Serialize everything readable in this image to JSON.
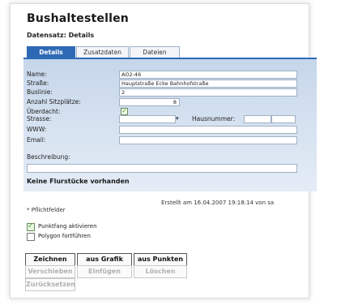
{
  "title": "Bushaltestellen",
  "subtitle": "Datensatz: Details",
  "tabs": [
    {
      "label": "Details",
      "active": true
    },
    {
      "label": "Zusatzdaten",
      "active": false
    },
    {
      "label": "Dateien",
      "active": false
    }
  ],
  "form": {
    "name": {
      "label": "Name:",
      "value": "AO2-46"
    },
    "strasse": {
      "label": "Straße:",
      "value": "Hauptstraße Ecke Bahnhofstraße"
    },
    "buslinie": {
      "label": "Buslinie:",
      "value": "2"
    },
    "sitzplaetze": {
      "label": "Anzahl Sitzplätze:",
      "value": "8"
    },
    "ueberdacht": {
      "label": "Überdacht:",
      "checked": true
    },
    "strasse2": {
      "label": "Strasse:",
      "value": "",
      "dropdown_symbol": "▾"
    },
    "hausnummer": {
      "label": "Hausnummer:",
      "value": "",
      "value2": ""
    },
    "www": {
      "label": "WWW:",
      "value": ""
    },
    "email": {
      "label": "Email:",
      "value": ""
    },
    "beschreibung": {
      "label": "Beschreibung:",
      "value": ""
    }
  },
  "flurstuecke": "Keine Flurstücke vorhanden",
  "created": "Erstellt am 16.04.2007 19:18:14 von sa",
  "required_note": "* Pflichtfelder",
  "options": [
    {
      "label": "Punktfang aktivieren",
      "checked": true
    },
    {
      "label": "Polygon fortführen",
      "checked": false
    }
  ],
  "buttons": {
    "zeichnen": "Zeichnen",
    "aus_grafik": "aus Grafik",
    "aus_punkten": "aus Punkten",
    "verschieben": "Verschieben",
    "einfuegen": "Einfügen",
    "loeschen": "Löschen",
    "zuruecksetzen": "Zurücksetzen"
  },
  "colors": {
    "accent": "#2e69b5",
    "panel_bg": "#d7e3f1"
  }
}
